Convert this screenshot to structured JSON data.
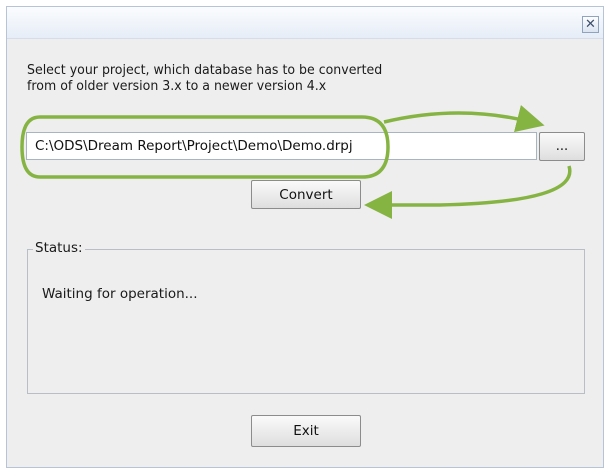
{
  "window": {
    "close_glyph": "✕"
  },
  "instruction": {
    "line1": "Select your project, which database has to be converted",
    "line2": "from of older version 3.x to a newer version 4.x"
  },
  "project_path": {
    "value": "C:\\ODS\\Dream Report\\Project\\Demo\\Demo.drpj"
  },
  "browse_button": {
    "label": "..."
  },
  "convert_button": {
    "label": "Convert"
  },
  "status": {
    "legend": "Status:",
    "message": "Waiting for operation..."
  },
  "exit_button": {
    "label": "Exit"
  },
  "colors": {
    "annotation": "#86b443",
    "window_bg": "#eeeeef",
    "titlebar": "#e6edf7"
  },
  "icons": {
    "close": "close-icon",
    "annotation_arrows": "arrow-icon"
  }
}
